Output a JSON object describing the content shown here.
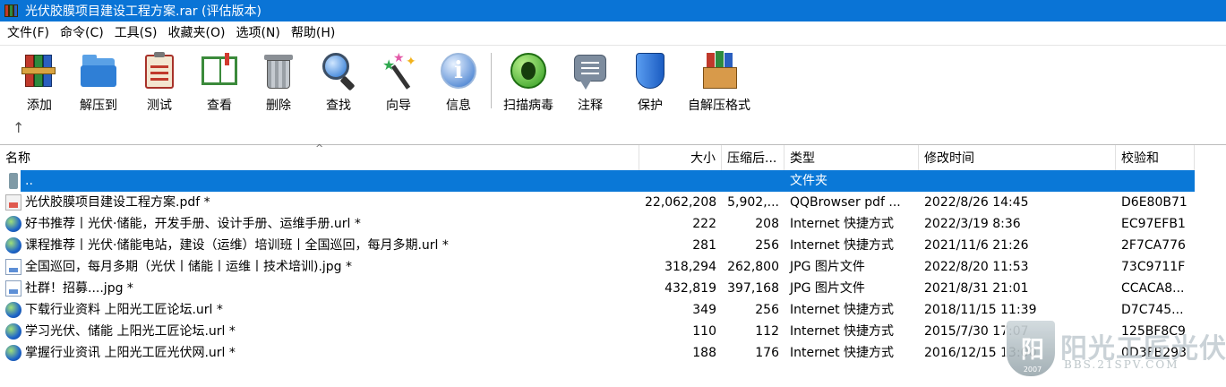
{
  "window": {
    "title": "光伏胶膜项目建设工程方案.rar (评估版本)"
  },
  "menu": [
    "文件(F)",
    "命令(C)",
    "工具(S)",
    "收藏夹(O)",
    "选项(N)",
    "帮助(H)"
  ],
  "toolbar": {
    "add": "添加",
    "extract": "解压到",
    "test": "测试",
    "view": "查看",
    "delete": "删除",
    "find": "查找",
    "wizard": "向导",
    "info": "信息",
    "virus": "扫描病毒",
    "comment": "注释",
    "protect": "保护",
    "sfx": "自解压格式"
  },
  "columns": {
    "name": "名称",
    "size": "大小",
    "packed": "压缩后...",
    "type": "类型",
    "modified": "修改时间",
    "crc": "校验和"
  },
  "rows": [
    {
      "name": "..",
      "size": "",
      "packed": "",
      "type": "文件夹",
      "modified": "",
      "crc": "",
      "icon": "up-folder-icon"
    },
    {
      "name": "光伏胶膜项目建设工程方案.pdf *",
      "size": "22,062,208",
      "packed": "5,902,...",
      "type": "QQBrowser pdf ...",
      "modified": "2022/8/26 14:45",
      "crc": "D6E80B71",
      "icon": "pdf-file-icon"
    },
    {
      "name": "好书推荐丨光伏·储能，开发手册、设计手册、运维手册.url *",
      "size": "222",
      "packed": "208",
      "type": "Internet 快捷方式",
      "modified": "2022/3/19 8:36",
      "crc": "EC97EFB1",
      "icon": "globe-icon"
    },
    {
      "name": "课程推荐丨光伏·储能电站，建设（运维）培训班丨全国巡回，每月多期.url *",
      "size": "281",
      "packed": "256",
      "type": "Internet 快捷方式",
      "modified": "2021/11/6 21:26",
      "crc": "2F7CA776",
      "icon": "globe-icon"
    },
    {
      "name": "全国巡回，每月多期（光伏丨储能丨运维丨技术培训).jpg *",
      "size": "318,294",
      "packed": "262,800",
      "type": "JPG 图片文件",
      "modified": "2022/8/20 11:53",
      "crc": "73C9711F",
      "icon": "image-file-icon"
    },
    {
      "name": "社群！招募....jpg *",
      "size": "432,819",
      "packed": "397,168",
      "type": "JPG 图片文件",
      "modified": "2021/8/31 21:01",
      "crc": "CCACA8...",
      "icon": "image-file-icon"
    },
    {
      "name": "下载行业资料 上阳光工匠论坛.url *",
      "size": "349",
      "packed": "256",
      "type": "Internet 快捷方式",
      "modified": "2018/11/15 11:39",
      "crc": "D7C745...",
      "icon": "globe-icon"
    },
    {
      "name": "学习光伏、储能 上阳光工匠论坛.url *",
      "size": "110",
      "packed": "112",
      "type": "Internet 快捷方式",
      "modified": "2015/7/30 17:07",
      "crc": "125BF8C9",
      "icon": "globe-icon"
    },
    {
      "name": "掌握行业资讯 上阳光工匠光伏网.url *",
      "size": "188",
      "packed": "176",
      "type": "Internet 快捷方式",
      "modified": "2016/12/15 13:00",
      "crc": "0D3FB293",
      "icon": "globe-icon"
    }
  ],
  "watermark": {
    "badge": "阳",
    "year": "2007",
    "title": "阳光工匠光伏论坛",
    "url": "BBS.21SPV.COM"
  },
  "colors": {
    "titlebar": "#0a74d6",
    "selection": "#0a78d7"
  }
}
